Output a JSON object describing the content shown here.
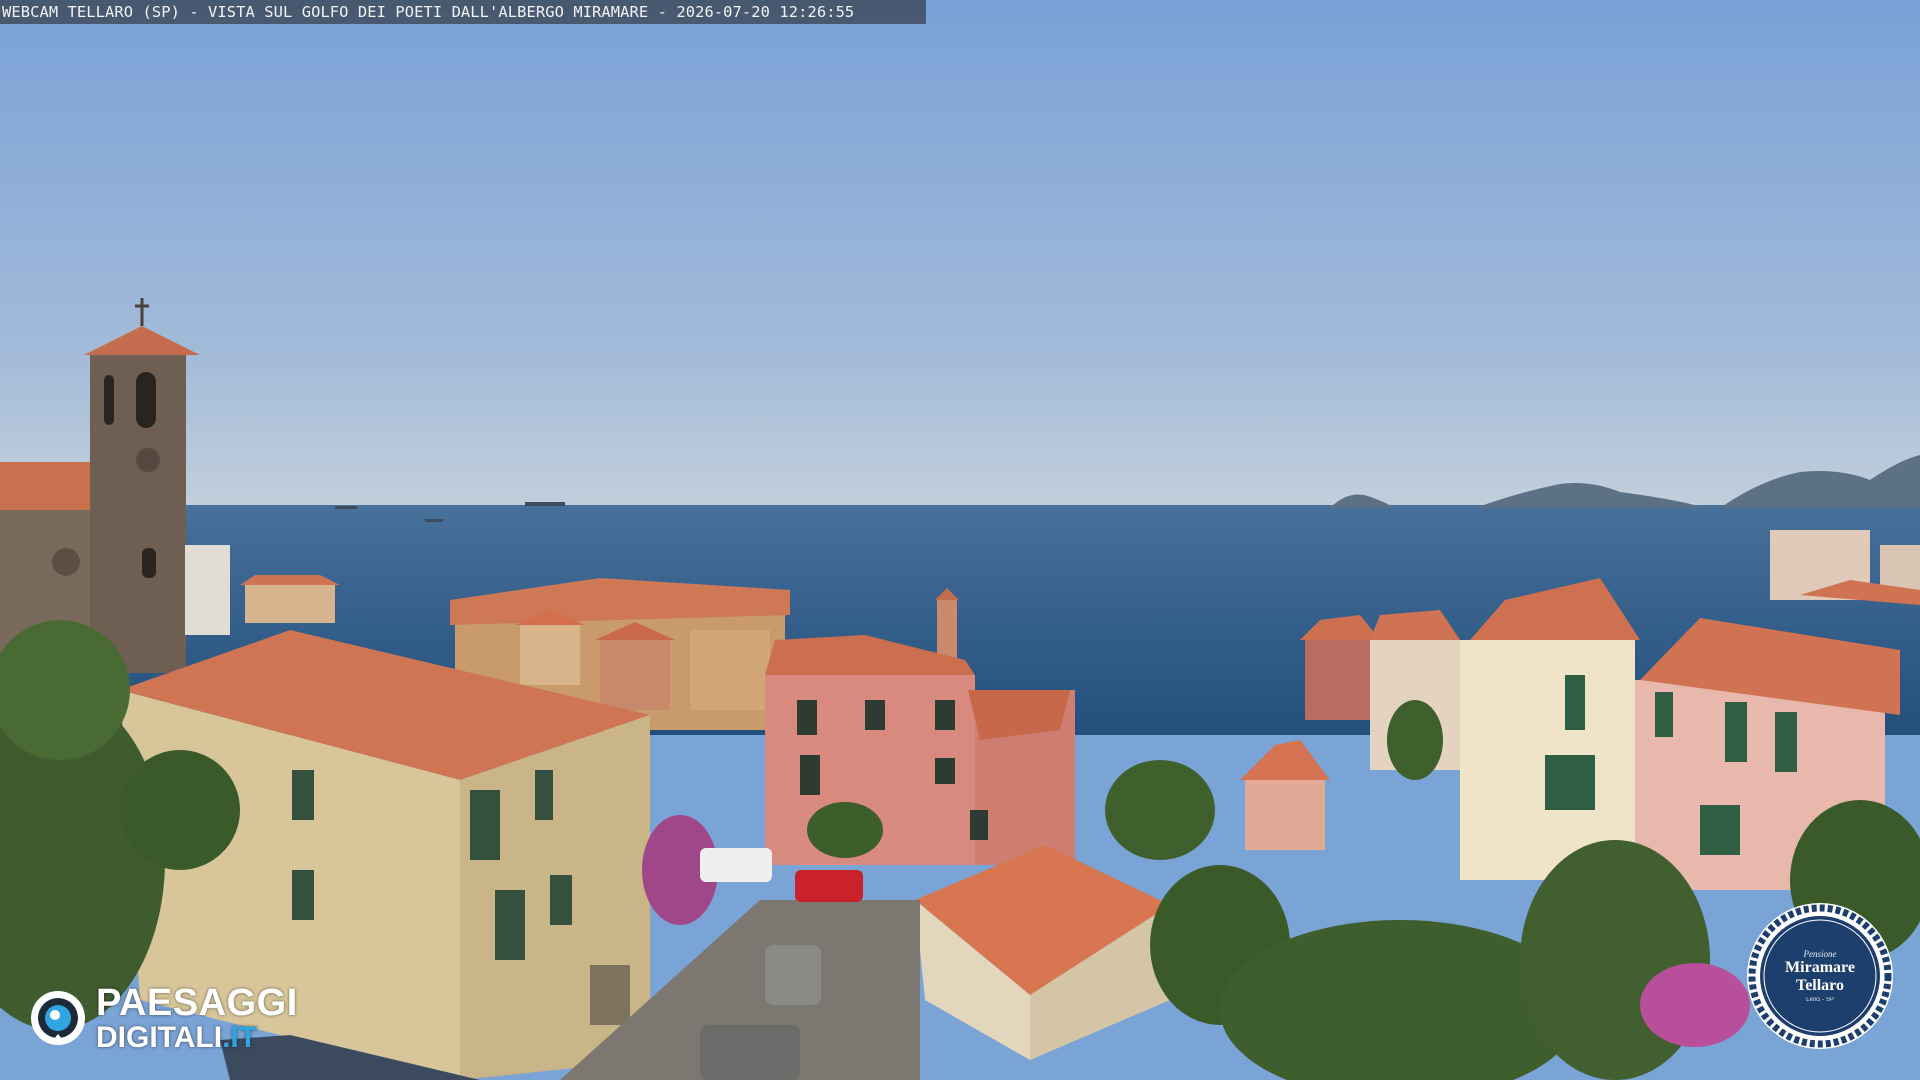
{
  "overlay": {
    "caption": "WEBCAM TELLARO (SP) - VISTA SUL GOLFO DEI POETI DALL'ALBERGO MIRAMARE - 2026-07-20 12:26:55"
  },
  "logo": {
    "line1": "PAESAGGI",
    "line2": "DIGITALI",
    "line2_suffix": ".IT",
    "accent_color": "#2fa6e0"
  },
  "badge": {
    "small_text": "Pensione",
    "title_line1": "Miramare",
    "title_line2": "Tellaro",
    "bottom_text": "Lerici - SP",
    "ring_color": "#1d3f6e"
  },
  "scene": {
    "sky_top": "#7a9fd4",
    "sky_horizon": "#b7c9de",
    "sea": "#2f5b86",
    "roof": "#d4765a"
  }
}
